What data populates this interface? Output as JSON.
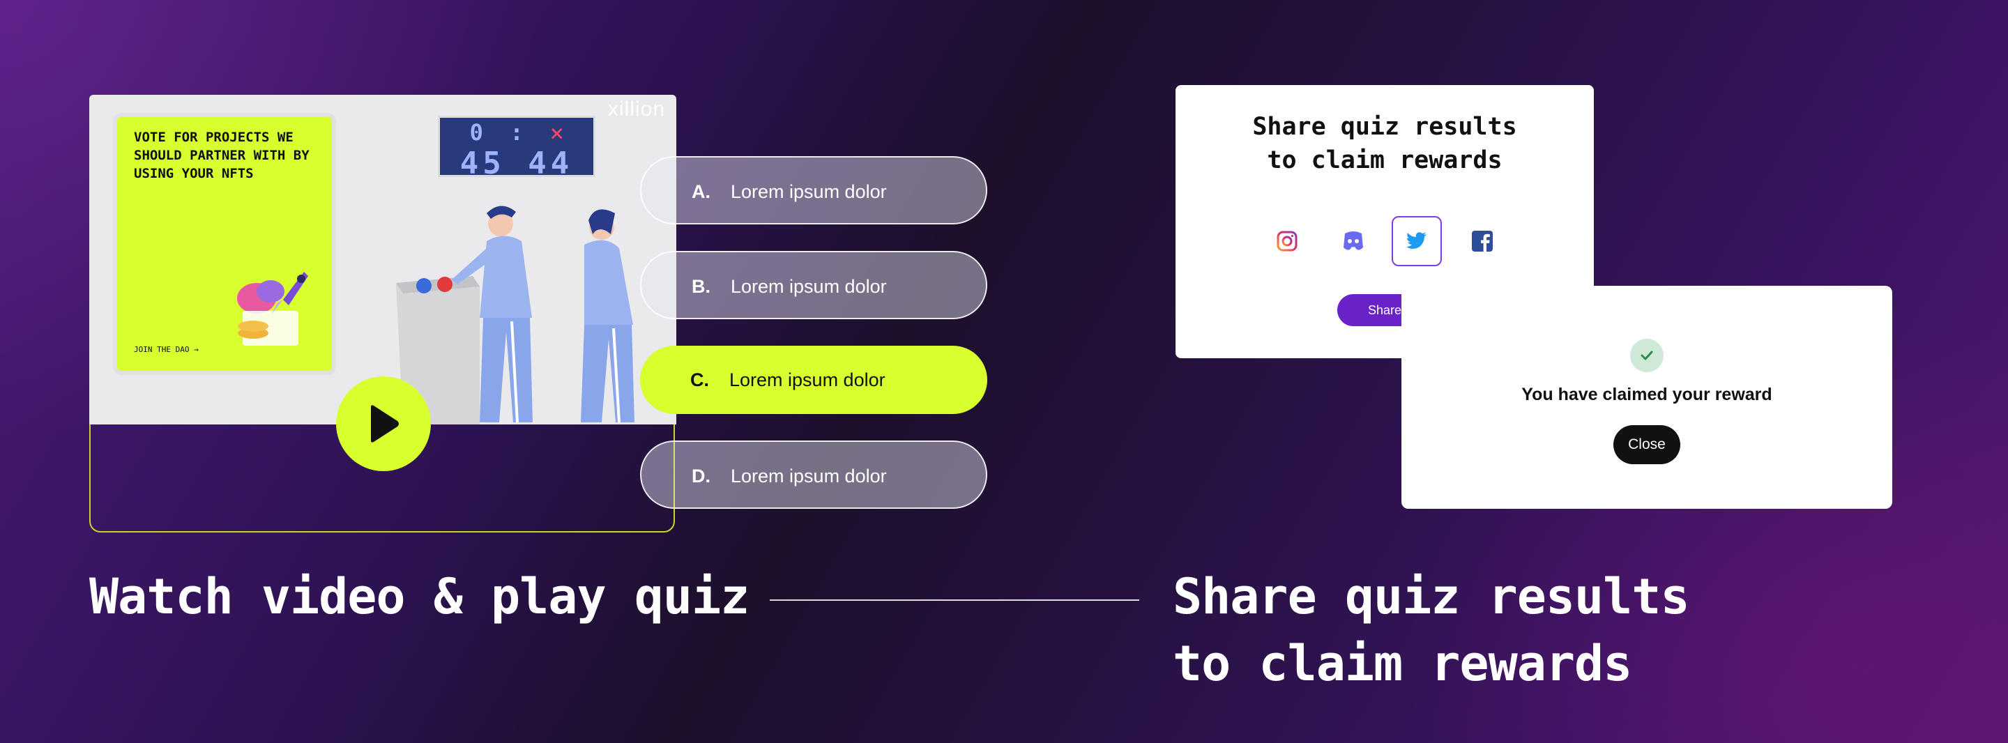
{
  "video": {
    "brand": "xillion",
    "poster_title": "VOTE FOR PROJECTS WE SHOULD PARTNER WITH BY USING YOUR NFTS",
    "poster_cta": "JOIN THE DAO →",
    "scoreboard_top_left": "0",
    "scoreboard_sep": ":",
    "scoreboard_top_right": "✕",
    "scoreboard_left": "45",
    "scoreboard_right": "44"
  },
  "quiz": {
    "options": [
      {
        "letter": "A.",
        "text": "Lorem ipsum dolor",
        "selected": false
      },
      {
        "letter": "B.",
        "text": "Lorem ipsum dolor",
        "selected": false
      },
      {
        "letter": "C.",
        "text": "Lorem ipsum dolor",
        "selected": true
      },
      {
        "letter": "D.",
        "text": "Lorem ipsum dolor",
        "selected": false
      }
    ]
  },
  "share_card": {
    "title_line1": "Share quiz results",
    "title_line2": "to claim rewards",
    "socials": [
      "instagram-icon",
      "discord-icon",
      "twitter-icon",
      "facebook-icon"
    ],
    "active_social": "twitter-icon",
    "button_label": "Share"
  },
  "claim_modal": {
    "message": "You have claimed your reward",
    "close_label": "Close"
  },
  "captions": {
    "left": "Watch video & play quiz",
    "right_line1": "Share quiz results",
    "right_line2": "to claim rewards"
  },
  "colors": {
    "accent_lime": "#d8ff2e",
    "share_purple": "#6a22c8",
    "twitter_blue": "#1d9bf0"
  }
}
